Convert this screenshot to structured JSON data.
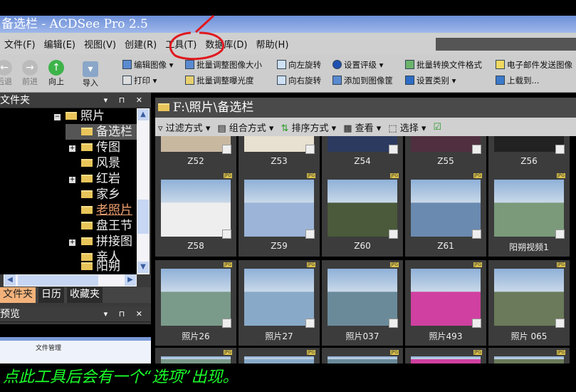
{
  "window": {
    "title": "备选栏 - ACDSee Pro 2.5"
  },
  "menu": [
    "文件(F)",
    "编辑(E)",
    "视图(V)",
    "创建(R)",
    "工具(T)",
    "数据库(D)",
    "帮助(H)"
  ],
  "nav": {
    "back": "后退",
    "forward": "前进",
    "up": "向上",
    "import": "导入"
  },
  "toolbar": {
    "edit_image": "编辑图像",
    "print": "打印",
    "batch_resize": "批量调整图像大小",
    "batch_exposure": "批量调整曝光度",
    "rotate_left": "向左旋转",
    "rotate_right": "向右旋转",
    "set_rating": "设置评级",
    "add_to_basket": "添加到图像筐",
    "batch_convert": "批量转换文件格式",
    "set_category": "设置类别",
    "email": "电子邮件发送图像",
    "upload": "上载到..."
  },
  "folders_panel": {
    "title": "文件夹",
    "tree": [
      {
        "label": "照片",
        "expanded": true
      },
      {
        "label": "备选栏",
        "selected": true
      },
      {
        "label": "传图",
        "has_children": true
      },
      {
        "label": "风景"
      },
      {
        "label": "红岩",
        "has_children": true
      },
      {
        "label": "家乡"
      },
      {
        "label": "老照片",
        "highlight": true
      },
      {
        "label": "盘王节"
      },
      {
        "label": "拼接图",
        "has_children": true
      },
      {
        "label": "亲人"
      },
      {
        "label": "阳朔"
      }
    ]
  },
  "tabs": [
    "文件夹",
    "日历",
    "收藏夹"
  ],
  "preview_panel": {
    "title": "预览",
    "preview_text": "文件管理"
  },
  "browser": {
    "path": "F:\\照片\\备选栏",
    "toolbar": [
      "过滤方式",
      "组合方式",
      "排序方式",
      "查看",
      "选择"
    ],
    "rows": [
      [
        "Z52",
        "Z53",
        "Z54",
        "Z55",
        "Z56"
      ],
      [
        "Z58",
        "Z59",
        "Z60",
        "Z61",
        "阳朔视频1"
      ],
      [
        "照片26",
        "照片27",
        "照片037",
        "照片493",
        "照片 065"
      ]
    ],
    "file_badge": "JPG"
  },
  "caption": "点此工具后会有一个“选项”出现。",
  "colors": {
    "annotation": "#e0191f",
    "caption": "#1bff2a"
  }
}
